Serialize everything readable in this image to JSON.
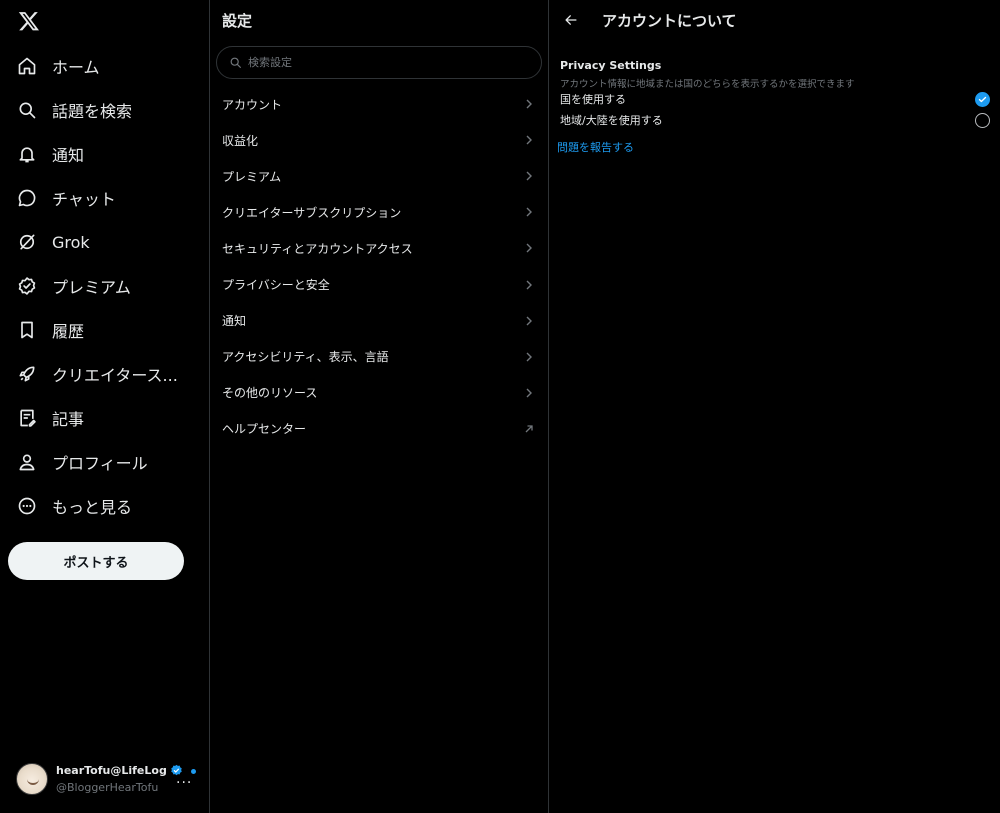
{
  "nav": {
    "logo_icon": "x-logo-icon",
    "items": [
      {
        "label": "ホーム",
        "icon": "home-icon"
      },
      {
        "label": "話題を検索",
        "icon": "search-icon"
      },
      {
        "label": "通知",
        "icon": "bell-icon"
      },
      {
        "label": "チャット",
        "icon": "chat-icon"
      },
      {
        "label": "Grok",
        "icon": "grok-icon"
      },
      {
        "label": "プレミアム",
        "icon": "verified-icon"
      },
      {
        "label": "履歴",
        "icon": "bookmark-icon"
      },
      {
        "label": "クリエイタース...",
        "icon": "rocket-icon"
      },
      {
        "label": "記事",
        "icon": "article-icon"
      },
      {
        "label": "プロフィール",
        "icon": "person-icon"
      },
      {
        "label": "もっと見る",
        "icon": "more-circle-icon"
      }
    ],
    "post_button": "ポストする"
  },
  "account": {
    "name": "hearTofu@LifeLog",
    "handle": "@BloggerHearTofu",
    "more": "..."
  },
  "settings": {
    "title": "設定",
    "search_placeholder": "検索設定",
    "items": [
      {
        "label": "アカウント",
        "icon": "chevron-right-icon"
      },
      {
        "label": "収益化",
        "icon": "chevron-right-icon"
      },
      {
        "label": "プレミアム",
        "icon": "chevron-right-icon"
      },
      {
        "label": "クリエイターサブスクリプション",
        "icon": "chevron-right-icon"
      },
      {
        "label": "セキュリティとアカウントアクセス",
        "icon": "chevron-right-icon"
      },
      {
        "label": "プライバシーと安全",
        "icon": "chevron-right-icon"
      },
      {
        "label": "通知",
        "icon": "chevron-right-icon"
      },
      {
        "label": "アクセシビリティ、表示、言語",
        "icon": "chevron-right-icon"
      },
      {
        "label": "その他のリソース",
        "icon": "chevron-right-icon"
      },
      {
        "label": "ヘルプセンター",
        "icon": "external-link-icon"
      }
    ]
  },
  "detail": {
    "title": "アカウントについて",
    "section_title": "Privacy Settings",
    "section_desc": "アカウント情報に地域または国のどちらを表示するかを選択できます",
    "options": [
      {
        "label": "国を使用する",
        "selected": true
      },
      {
        "label": "地域/大陸を使用する",
        "selected": false
      }
    ],
    "report_link": "問題を報告する"
  },
  "colors": {
    "background": "#000000",
    "text": "#e7e9ea",
    "muted": "#71767b",
    "accent": "#1d9bf0",
    "border": "#2f3336"
  }
}
